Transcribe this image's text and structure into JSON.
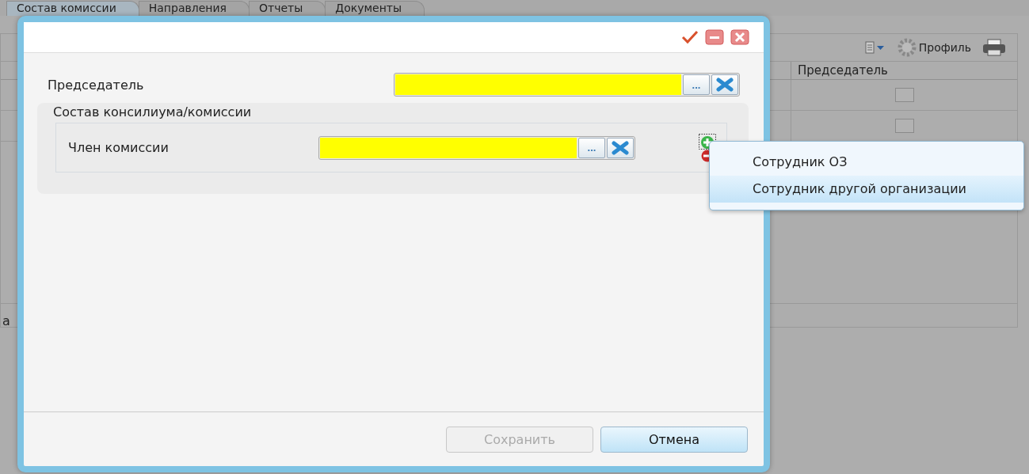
{
  "background": {
    "tabs": [
      {
        "label": "Состав комиссии",
        "selected": true
      },
      {
        "label": "Направления",
        "selected": false
      },
      {
        "label": "Отчеты",
        "selected": false
      },
      {
        "label": "Документы",
        "selected": false
      }
    ],
    "toolbar": {
      "profile_label": "Профиль"
    },
    "table": {
      "columns": [
        "Председатель"
      ],
      "rows": [
        {
          "checked": false
        },
        {
          "checked": false
        }
      ]
    },
    "fragment": "а"
  },
  "dialog": {
    "fields": [
      {
        "label": "Председатель",
        "required": true,
        "browse_label": "..."
      }
    ],
    "fieldset": {
      "legend": "Состав консилиума/комиссии",
      "fields": [
        {
          "label": "Член комиссии",
          "required": true,
          "browse_label": "..."
        }
      ]
    },
    "buttons": [
      {
        "label": "Сохранить",
        "disabled": true
      },
      {
        "label": "Отмена",
        "disabled": false
      }
    ]
  },
  "menu": {
    "items": [
      {
        "label": "Сотрудник ОЗ",
        "selected": false
      },
      {
        "label": "Сотрудник другой организации",
        "selected": true
      }
    ]
  }
}
